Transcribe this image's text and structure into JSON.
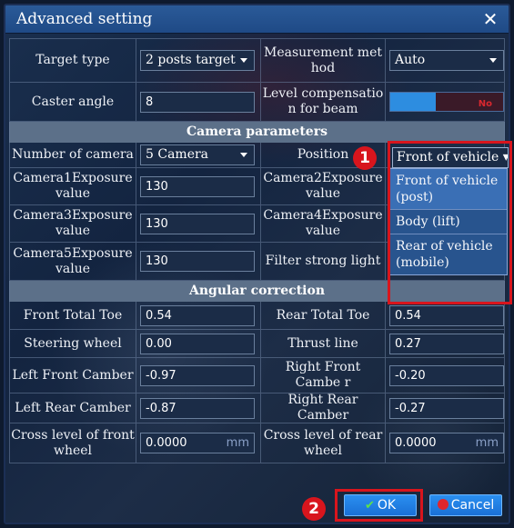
{
  "window": {
    "title": "Advanced setting"
  },
  "rows": {
    "target_type_label": "Target type",
    "target_type_value": "2 posts target",
    "measurement_label": "Measurement met hod",
    "measurement_value": "Auto",
    "caster_label": "Caster angle",
    "caster_value": "8",
    "level_comp_label": "Level compensatio n for beam",
    "level_comp_state": "No"
  },
  "camera_section": {
    "header": "Camera parameters",
    "num_camera_label": "Number of camera",
    "num_camera_value": "5 Camera",
    "position_label": "Position",
    "position_value": "Front of vehicle",
    "cam1_label": "Camera1Exposure value",
    "cam1_value": "130",
    "cam2_label": "Camera2Exposure value",
    "cam3_label": "Camera3Exposure value",
    "cam3_value": "130",
    "cam4_label": "Camera4Exposure value",
    "cam5_label": "Camera5Exposure value",
    "cam5_value": "130",
    "filter_label": "Filter strong light"
  },
  "position_options": [
    "Front of vehicle (post)",
    "Body (lift)",
    "Rear of vehicle (mobile)"
  ],
  "angular_section": {
    "header": "Angular correction",
    "front_toe_label": "Front Total Toe",
    "front_toe_value": "0.54",
    "rear_toe_label": "Rear Total Toe",
    "rear_toe_value": "0.54",
    "steering_label": "Steering wheel",
    "steering_value": "0.00",
    "thrust_label": "Thrust line",
    "thrust_value": "0.27",
    "lf_camber_label": "Left Front Camber",
    "lf_camber_value": "-0.97",
    "rf_camber_label": "Right Front Cambe r",
    "rf_camber_value": "-0.20",
    "lr_camber_label": "Left Rear Camber",
    "lr_camber_value": "-0.87",
    "rr_camber_label": "Right Rear Camber",
    "rr_camber_value": "-0.27",
    "cross_front_label": "Cross level of front wheel",
    "cross_front_value": "0.0000",
    "cross_rear_label": "Cross level of rear wheel",
    "cross_rear_value": "0.0000",
    "unit": "mm"
  },
  "markers": {
    "one": "1",
    "two": "2"
  },
  "buttons": {
    "ok": "OK",
    "cancel": "Cancel"
  },
  "colors": {
    "highlight": "#d8151d",
    "accent": "#1a70d6"
  }
}
